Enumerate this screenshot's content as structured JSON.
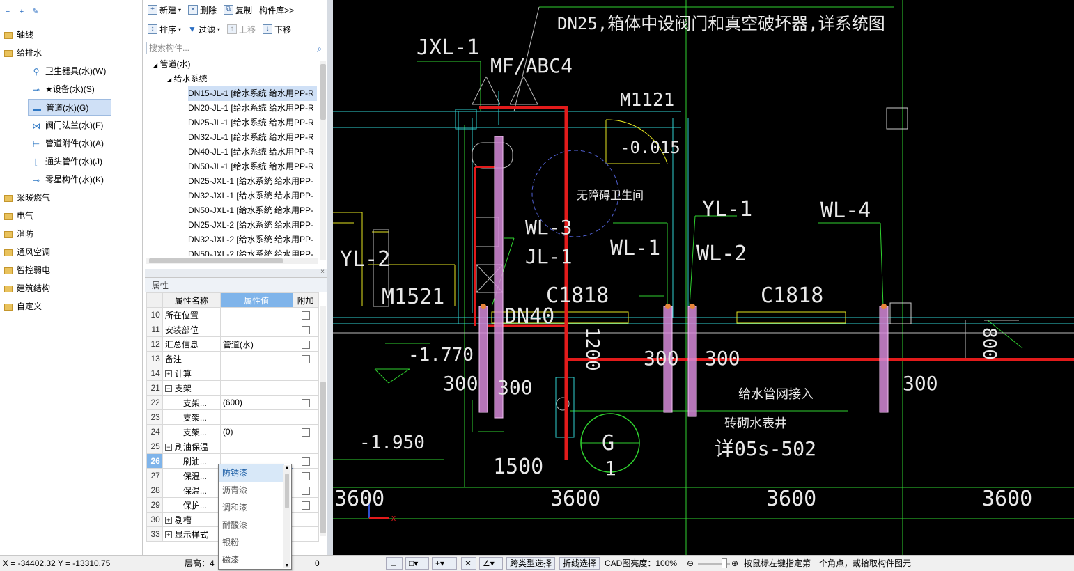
{
  "tree": {
    "items": [
      {
        "label": "轴线",
        "level": 0,
        "icon": "folder-icon"
      },
      {
        "label": "给排水",
        "level": 0,
        "icon": "folder-icon"
      },
      {
        "label": "卫生器具(水)(W)",
        "level": 1,
        "icon": "sanitary-fixture-icon"
      },
      {
        "label": "★设备(水)(S)",
        "level": 1,
        "icon": "equipment-icon"
      },
      {
        "label": "管道(水)(G)",
        "level": 1,
        "icon": "pipe-icon",
        "selected": true
      },
      {
        "label": "阀门法兰(水)(F)",
        "level": 1,
        "icon": "valve-icon"
      },
      {
        "label": "管道附件(水)(A)",
        "level": 1,
        "icon": "pipe-accessory-icon"
      },
      {
        "label": "通头管件(水)(J)",
        "level": 1,
        "icon": "pipe-fitting-icon"
      },
      {
        "label": "零星构件(水)(K)",
        "level": 1,
        "icon": "misc-component-icon"
      },
      {
        "label": "采暖燃气",
        "level": 0,
        "icon": "folder-icon"
      },
      {
        "label": "电气",
        "level": 0,
        "icon": "folder-icon"
      },
      {
        "label": "消防",
        "level": 0,
        "icon": "folder-icon"
      },
      {
        "label": "通风空调",
        "level": 0,
        "icon": "folder-icon"
      },
      {
        "label": "智控弱电",
        "level": 0,
        "icon": "folder-icon"
      },
      {
        "label": "建筑结构",
        "level": 0,
        "icon": "folder-icon"
      },
      {
        "label": "自定义",
        "level": 0,
        "icon": "folder-icon"
      }
    ]
  },
  "toolbar": {
    "new": "新建",
    "delete": "删除",
    "copy": "复制",
    "library": "构件库>>",
    "sort": "排序",
    "filter": "过滤",
    "up": "上移",
    "down": "下移",
    "search_placeholder": "搜索构件..."
  },
  "components": {
    "root": "管道(水)",
    "group": "给水系统",
    "items": [
      "DN15-JL-1 [给水系统 给水用PP-R",
      "DN20-JL-1 [给水系统 给水用PP-R",
      "DN25-JL-1 [给水系统 给水用PP-R",
      "DN32-JL-1 [给水系统 给水用PP-R",
      "DN40-JL-1 [给水系统 给水用PP-R",
      "DN50-JL-1 [给水系统 给水用PP-R",
      "DN25-JXL-1 [给水系统 给水用PP-",
      "DN32-JXL-1 [给水系统 给水用PP-",
      "DN50-JXL-1 [给水系统 给水用PP-",
      "DN25-JXL-2 [给水系统 给水用PP-",
      "DN32-JXL-2 [给水系统 给水用PP-",
      "DN50-JXL-2 [给水系统 给水用PP-"
    ]
  },
  "properties": {
    "title": "属性",
    "col_name": "属性名称",
    "col_value": "属性值",
    "col_extra": "附加",
    "rows": [
      {
        "n": "10",
        "name": "所在位置",
        "value": "",
        "cb": true
      },
      {
        "n": "11",
        "name": "安装部位",
        "value": "",
        "cb": true
      },
      {
        "n": "12",
        "name": "汇总信息",
        "value": "管道(水)",
        "cb": true
      },
      {
        "n": "13",
        "name": "备注",
        "value": "",
        "cb": true
      },
      {
        "n": "14",
        "name": "计算",
        "value": "",
        "group": "+"
      },
      {
        "n": "21",
        "name": "支架",
        "value": "",
        "group": "-"
      },
      {
        "n": "22",
        "name": "支架...",
        "value": "(600)",
        "cb": true,
        "indent": true
      },
      {
        "n": "23",
        "name": "支架...",
        "value": "",
        "indent": true
      },
      {
        "n": "24",
        "name": "支架...",
        "value": "(0)",
        "cb": true,
        "indent": true
      },
      {
        "n": "25",
        "name": "刷油保温",
        "value": "",
        "group": "-"
      },
      {
        "n": "26",
        "name": "刷油...",
        "value": "",
        "cb": true,
        "indent": true,
        "active": true
      },
      {
        "n": "27",
        "name": "保温...",
        "value": "",
        "cb": true,
        "indent": true
      },
      {
        "n": "28",
        "name": "保温...",
        "value": "",
        "cb": true,
        "indent": true
      },
      {
        "n": "29",
        "name": "保护...",
        "value": "",
        "cb": true,
        "indent": true
      },
      {
        "n": "30",
        "name": "剔槽",
        "value": "",
        "group": "+"
      },
      {
        "n": "33",
        "name": "显示样式",
        "value": "",
        "group": "+"
      }
    ],
    "dropdown": [
      "防锈漆",
      "沥青漆",
      "调和漆",
      "耐酸漆",
      "银粉",
      "磁漆"
    ]
  },
  "cad": {
    "texts": {
      "t1": "DN25,箱体中设阀门和真空破坏器,详系统图",
      "t2": "JXL-1",
      "t3": "MF/ABC4",
      "t4": "M1121",
      "t5": "-0.015",
      "t6": "无障碍卫生间",
      "t7": "YL-1",
      "t8": "WL-4",
      "t9": "WL-3",
      "t10": "JL-1",
      "t11": "WL-1",
      "t12": "WL-2",
      "t13": "YL-2",
      "t14": "M1521",
      "t15": "C1818",
      "t16": "C1818",
      "t17": "DN40",
      "t18": "-1.770",
      "t19": "1200",
      "t20": "300",
      "t21": "300",
      "t22": "300",
      "t23": "300",
      "t24": "800",
      "t25": "300",
      "t26": "给水管网接入",
      "t27": "砖砌水表井",
      "t28": "详05s-502",
      "t29": "-1.950",
      "t30": "G",
      "t31": "1",
      "t32": "1500",
      "t33": "3600",
      "t34": "3600",
      "t35": "3600",
      "t36": "3600",
      "t37": "X"
    }
  },
  "status": {
    "coords": "X = -34402.32 Y = -13310.75",
    "floor_height": "层高：4",
    "zero": "0",
    "cross_type": "跨类型选择",
    "polyline": "折线选择",
    "cad_brightness": "CAD图亮度：100%",
    "hint": "按鼠标左键指定第一个角点，或拾取构件图元"
  },
  "colors": {
    "cad_bg": "#000000",
    "pipe_red": "#e21b1b",
    "grid_cyan": "#2fd1d1",
    "line_green": "#2fd12f",
    "riser_pink": "#d58ad8",
    "annot_yellow": "#e3e31f"
  }
}
